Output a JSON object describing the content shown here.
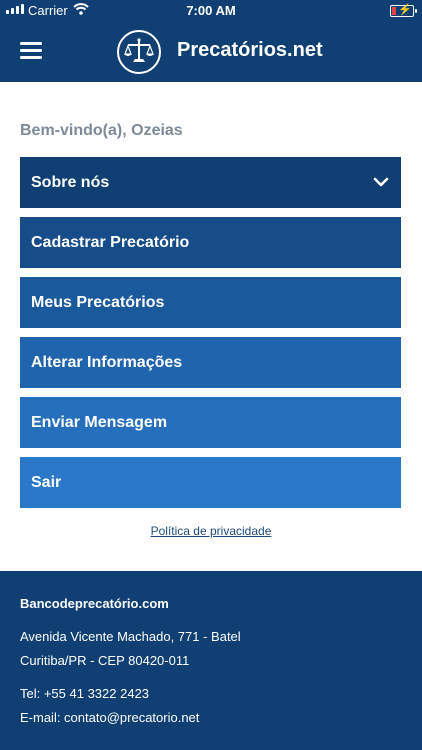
{
  "status_bar": {
    "carrier": "Carrier",
    "time": "7:00 AM"
  },
  "header": {
    "brand": "Precatórios.net",
    "color": "#0f3f73"
  },
  "welcome": "Bem-vindo(a), Ozeias",
  "menu": [
    {
      "label": "Sobre nós",
      "color": "#0f3f73"
    },
    {
      "label": "Cadastrar Precatório",
      "color": "#164d88"
    },
    {
      "label": "Meus Precatórios",
      "color": "#1a5a9c"
    },
    {
      "label": "Alterar Informações",
      "color": "#1f64ad"
    },
    {
      "label": "Enviar Mensagem",
      "color": "#256fbd"
    },
    {
      "label": "Sair",
      "color": "#2a78c7"
    }
  ],
  "privacy_link": "Política de privacidade",
  "footer": {
    "title": "Bancodeprecatório.com",
    "address_line1": "Avenida Vicente Machado, 771 - Batel",
    "address_line2": "Curitiba/PR - CEP 80420-011",
    "phone": "Tel: +55 41 3322 2423",
    "email": "E-mail: contato@precatorio.net"
  }
}
